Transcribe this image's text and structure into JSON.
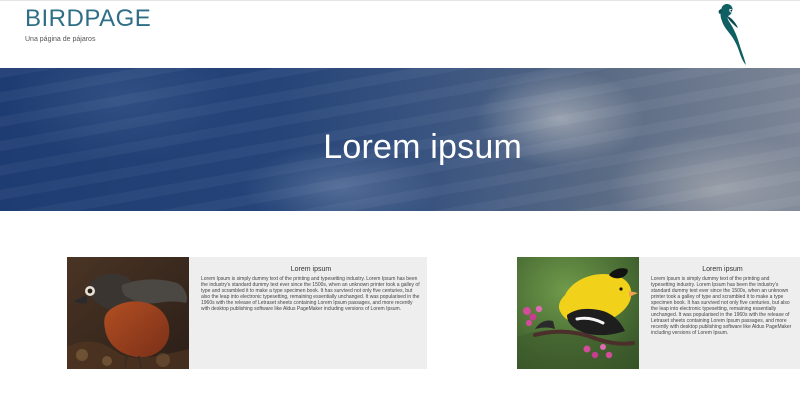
{
  "header": {
    "brand": "BIRDPAGE",
    "tagline": "Una página de pájaros",
    "logo_icon": "parrot-icon"
  },
  "hero": {
    "title": "Lorem ipsum"
  },
  "cards": [
    {
      "image_icon": "robin-photo",
      "title": "Lorem ipsum",
      "text": "Lorem Ipsum is simply dummy text of the printing and typesetting industry. Lorem Ipsum has been the industry's standard dummy text ever since the 1500s, when an unknown printer took a galley of type and scrambled it to make a type specimen book. It has survived not only five centuries, but also the leap into electronic typesetting, remaining essentially unchanged. It was popularised in the 1960s with the release of Letraset sheets containing Lorem Ipsum passages, and more recently with desktop publishing software like Aldus PageMaker including versions of Lorem Ipsum."
    },
    {
      "image_icon": "goldfinch-photo",
      "title": "Lorem ipsum",
      "text": "Lorem Ipsum is simply dummy text of the printing and typesetting industry. Lorem Ipsum has been the industry's standard dummy text ever since the 1500s, when an unknown printer took a galley of type and scrambled it to make a type specimen book. It has survived not only five centuries, but also the leap into electronic typesetting, remaining essentially unchanged. It was popularised in the 1960s with the release of Letraset sheets containing Lorem Ipsum passages, and more recently with desktop publishing software like Aldus PageMaker including versions of Lorem Ipsum."
    }
  ],
  "colors": {
    "brand": "#2f6f86",
    "hero_text": "#ffffff",
    "card_bg": "#eeeeee"
  }
}
